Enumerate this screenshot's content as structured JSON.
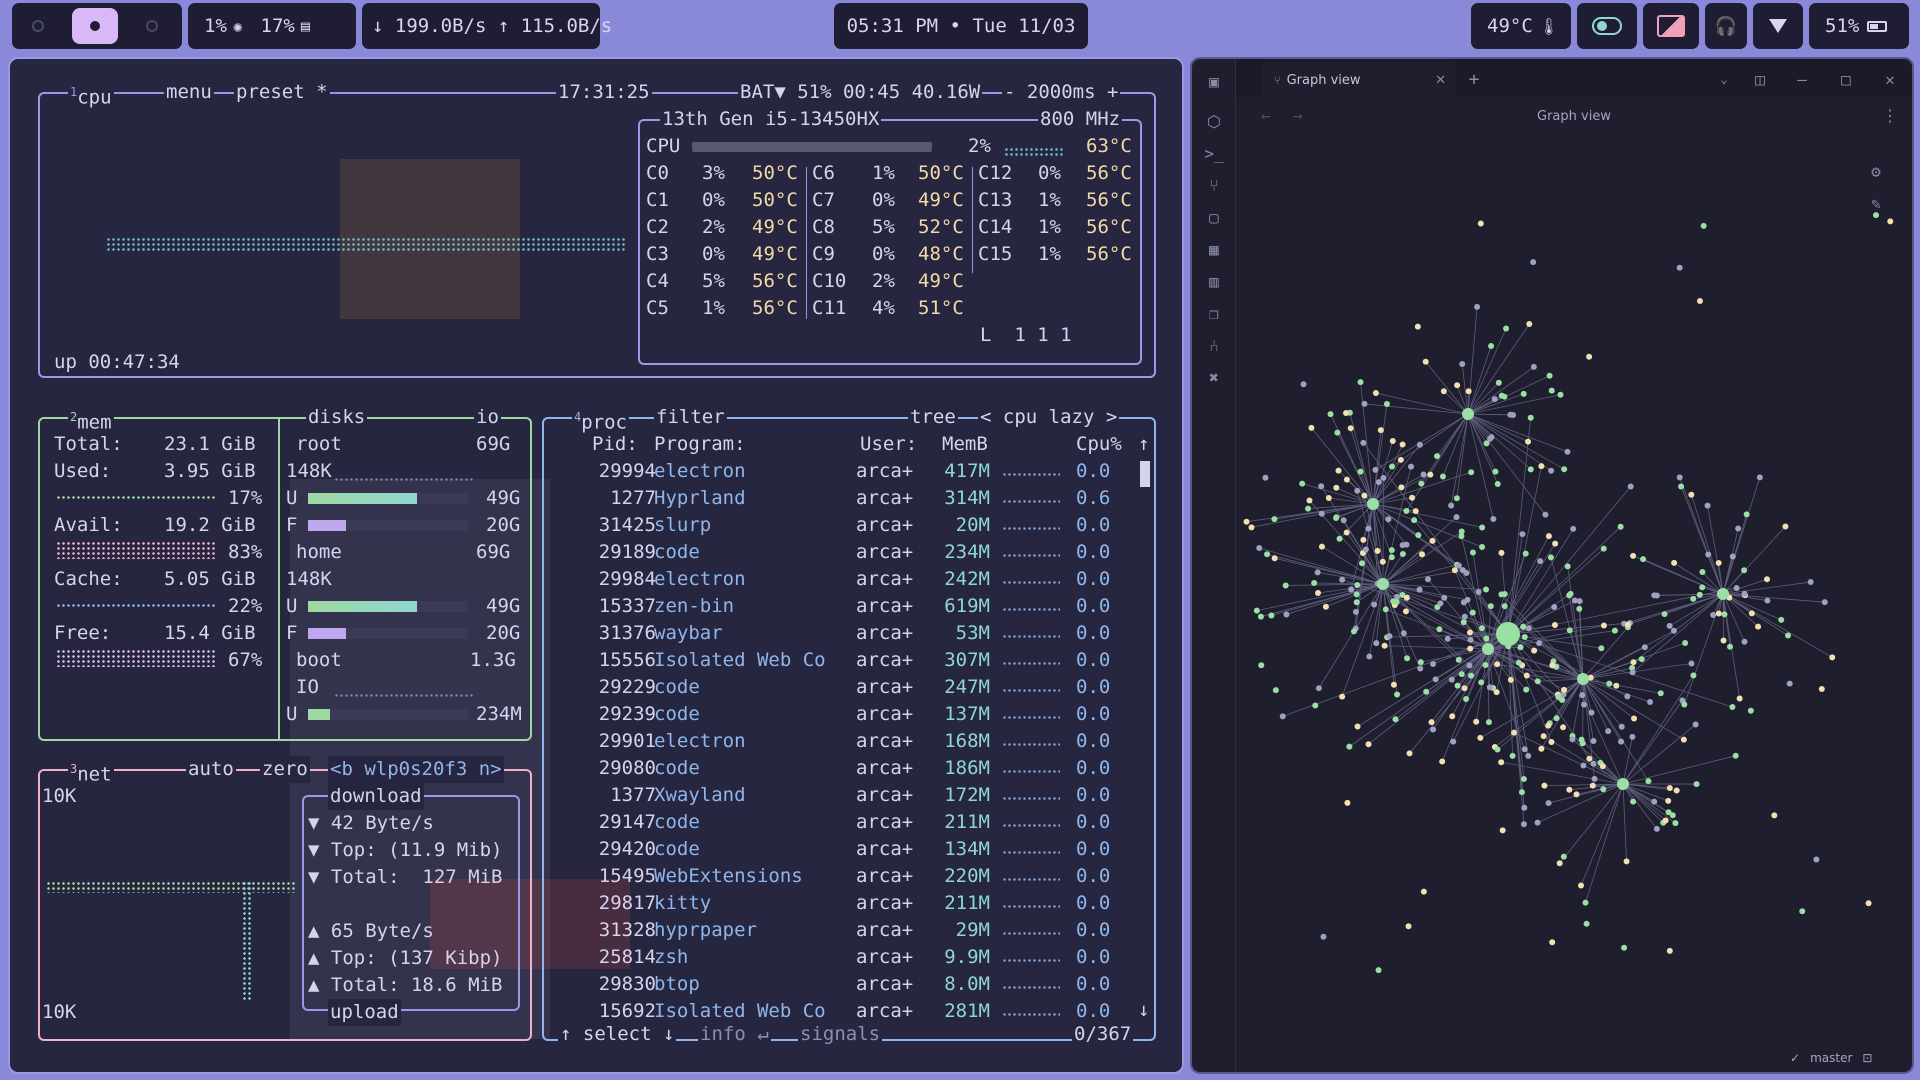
{
  "topbar": {
    "cpu": "1%",
    "ram": "17%",
    "net": "↓ 199.0B/s ↑ 115.0B/s",
    "clock": "05:31 PM • Tue 11/03",
    "temp": "49°C",
    "battery": "51%"
  },
  "btop": {
    "cpu_box": {
      "num": "1",
      "title": "cpu",
      "menu": "menu",
      "preset": "preset *",
      "time": "17:31:25",
      "bat": "BAT▼ 51% 00:45 40.16W",
      "refresh": "- 2000ms +",
      "uptime": "up 00:47:34",
      "model": "13th Gen i5-13450HX",
      "freq": "800 MHz",
      "cpu_label": "CPU",
      "cpu_pct": "2%",
      "cpu_temp": "63°C",
      "load": "L  1 1 1",
      "cores": [
        [
          {
            "n": "C0",
            "p": "3%",
            "t": "50°C"
          },
          {
            "n": "C6",
            "p": "1%",
            "t": "50°C"
          },
          {
            "n": "C12",
            "p": "0%",
            "t": "56°C"
          }
        ],
        [
          {
            "n": "C1",
            "p": "0%",
            "t": "50°C"
          },
          {
            "n": "C7",
            "p": "0%",
            "t": "49°C"
          },
          {
            "n": "C13",
            "p": "1%",
            "t": "56°C"
          }
        ],
        [
          {
            "n": "C2",
            "p": "2%",
            "t": "49°C"
          },
          {
            "n": "C8",
            "p": "5%",
            "t": "52°C"
          },
          {
            "n": "C14",
            "p": "1%",
            "t": "56°C"
          }
        ],
        [
          {
            "n": "C3",
            "p": "0%",
            "t": "49°C"
          },
          {
            "n": "C9",
            "p": "0%",
            "t": "48°C"
          },
          {
            "n": "C15",
            "p": "1%",
            "t": "56°C"
          }
        ],
        [
          {
            "n": "C4",
            "p": "5%",
            "t": "56°C"
          },
          {
            "n": "C10",
            "p": "2%",
            "t": "49°C"
          }
        ],
        [
          {
            "n": "C5",
            "p": "1%",
            "t": "56°C"
          },
          {
            "n": "C11",
            "p": "4%",
            "t": "51°C"
          }
        ]
      ]
    },
    "mem_box": {
      "num": "2",
      "title": "mem",
      "disks": "disks",
      "io": "io",
      "rows": [
        {
          "label": "Total:",
          "value": "23.1 GiB"
        },
        {
          "label": "Used:",
          "value": "3.95 GiB",
          "pct": "17%"
        },
        {
          "label": "Avail:",
          "value": "19.2 GiB",
          "pct": "83%"
        },
        {
          "label": "Cache:",
          "value": "5.05 GiB",
          "pct": "22%"
        },
        {
          "label": "Free:",
          "value": "15.4 GiB",
          "pct": "67%"
        }
      ],
      "disk_rows": [
        {
          "a": "root",
          "b": "69G"
        },
        {
          "a": "148K",
          "b": ""
        },
        {
          "a": "U",
          "b": "49G"
        },
        {
          "a": "F",
          "b": "20G"
        },
        {
          "a": "home",
          "b": "69G"
        },
        {
          "a": "148K",
          "b": ""
        },
        {
          "a": "U",
          "b": "49G"
        },
        {
          "a": "F",
          "b": "20G"
        },
        {
          "a": "boot",
          "b": "1.3G"
        },
        {
          "a": "IO",
          "b": ""
        },
        {
          "a": "U",
          "b": "234M"
        }
      ]
    },
    "net_box": {
      "num": "3",
      "title": "net",
      "auto": "auto",
      "zero": "zero",
      "iface": "<b wlp0s20f3 n>",
      "scale_top": "10K",
      "scale_bottom": "10K",
      "download": "download",
      "dl_rate": "▼ 42 Byte/s",
      "dl_top": "▼ Top: (11.9 Mib)",
      "dl_total": "▼ Total:  127 MiB",
      "ul_rate": "▲ 65 Byte/s",
      "ul_top": "▲ Top: (137 Kibp)",
      "ul_total": "▲ Total: 18.6 MiB",
      "upload": "upload"
    },
    "proc_box": {
      "num": "4",
      "title": "proc",
      "filter": "filter",
      "tree": "tree",
      "sort": "< cpu lazy >",
      "headers": {
        "pid": "Pid:",
        "prog": "Program:",
        "user": "User:",
        "mem": "MemB",
        "cpu": "Cpu%"
      },
      "rows": [
        [
          "29994",
          "electron",
          "arca+",
          "417M",
          "0.0"
        ],
        [
          "1277",
          "Hyprland",
          "arca+",
          "314M",
          "0.6"
        ],
        [
          "31425",
          "slurp",
          "arca+",
          "20M",
          "0.0"
        ],
        [
          "29189",
          "code",
          "arca+",
          "234M",
          "0.0"
        ],
        [
          "29984",
          "electron",
          "arca+",
          "242M",
          "0.0"
        ],
        [
          "15337",
          "zen-bin",
          "arca+",
          "619M",
          "0.0"
        ],
        [
          "31376",
          "waybar",
          "arca+",
          "53M",
          "0.0"
        ],
        [
          "15556",
          "Isolated Web Co",
          "arca+",
          "307M",
          "0.0"
        ],
        [
          "29229",
          "code",
          "arca+",
          "247M",
          "0.0"
        ],
        [
          "29239",
          "code",
          "arca+",
          "137M",
          "0.0"
        ],
        [
          "29901",
          "electron",
          "arca+",
          "168M",
          "0.0"
        ],
        [
          "29080",
          "code",
          "arca+",
          "186M",
          "0.0"
        ],
        [
          "1377",
          "Xwayland",
          "arca+",
          "172M",
          "0.0"
        ],
        [
          "29147",
          "code",
          "arca+",
          "211M",
          "0.0"
        ],
        [
          "29420",
          "code",
          "arca+",
          "134M",
          "0.0"
        ],
        [
          "15495",
          "WebExtensions",
          "arca+",
          "220M",
          "0.0"
        ],
        [
          "29817",
          "kitty",
          "arca+",
          "211M",
          "0.0"
        ],
        [
          "31328",
          "hyprpaper",
          "arca+",
          "29M",
          "0.0"
        ],
        [
          "25814",
          "zsh",
          "arca+",
          "9.9M",
          "0.0"
        ],
        [
          "29830",
          "btop",
          "arca+",
          "8.0M",
          "0.0"
        ],
        [
          "15692",
          "Isolated Web Co",
          "arca+",
          "281M",
          "0.0"
        ]
      ],
      "footer_select": "↑ select ↓",
      "footer_info": "info ↵",
      "footer_signals": "signals",
      "count": "0/367"
    }
  },
  "obsidian": {
    "tab_title": "Graph view",
    "view_title": "Graph view",
    "branch": "master"
  },
  "colors": {
    "accent": "#9c98e8",
    "green": "#9ed8a0",
    "blue": "#8fb6ec",
    "pink": "#f0b0c8",
    "teal": "#8fd6d0",
    "node_green": "#9ae0a4",
    "node_cream": "#f3e0b0"
  }
}
